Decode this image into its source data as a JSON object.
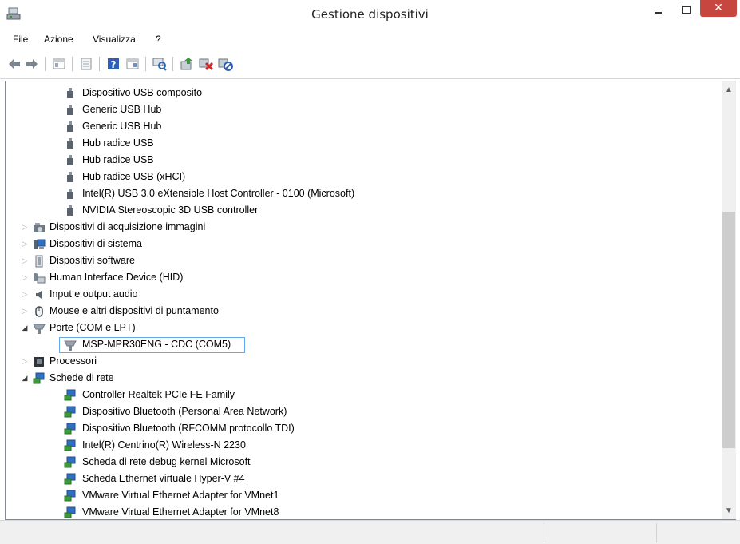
{
  "window": {
    "title": "Gestione dispositivi",
    "close_glyph": "✕"
  },
  "menu": [
    "File",
    "Azione",
    "Visualizza",
    "?"
  ],
  "toolbar_icons": [
    "back-icon",
    "forward-icon",
    "properties-view-icon",
    "show-hidden-icon",
    "help-icon",
    "properties-icon",
    "scan-hardware-icon",
    "update-driver-icon",
    "uninstall-icon",
    "disable-icon"
  ],
  "tree": {
    "usb_children": [
      "Dispositivo USB composito",
      "Generic USB Hub",
      "Generic USB Hub",
      "Hub radice USB",
      "Hub radice USB",
      "Hub radice USB (xHCI)",
      "Intel(R) USB 3.0 eXtensible Host Controller - 0100 (Microsoft)",
      "NVIDIA Stereoscopic 3D USB controller"
    ],
    "categories": [
      "Dispositivi di acquisizione immagini",
      "Dispositivi di sistema",
      "Dispositivi software",
      "Human Interface Device (HID)",
      "Input e output audio",
      "Mouse e altri dispositivi di puntamento",
      "Porte (COM e LPT)"
    ],
    "port_child": "MSP-MPR30ENG - CDC (COM5)",
    "processors": "Processori",
    "network": "Schede di rete",
    "network_children": [
      "Controller Realtek PCIe FE Family",
      "Dispositivo Bluetooth (Personal Area Network)",
      "Dispositivo Bluetooth (RFCOMM protocollo TDI)",
      "Intel(R) Centrino(R) Wireless-N 2230",
      "Scheda di rete debug kernel Microsoft",
      "Scheda Ethernet virtuale Hyper-V #4",
      "VMware Virtual Ethernet Adapter for VMnet1",
      "VMware Virtual Ethernet Adapter for VMnet8"
    ]
  },
  "colors": {
    "close_button": "#c7463f",
    "selection_border": "#66a7e8"
  }
}
